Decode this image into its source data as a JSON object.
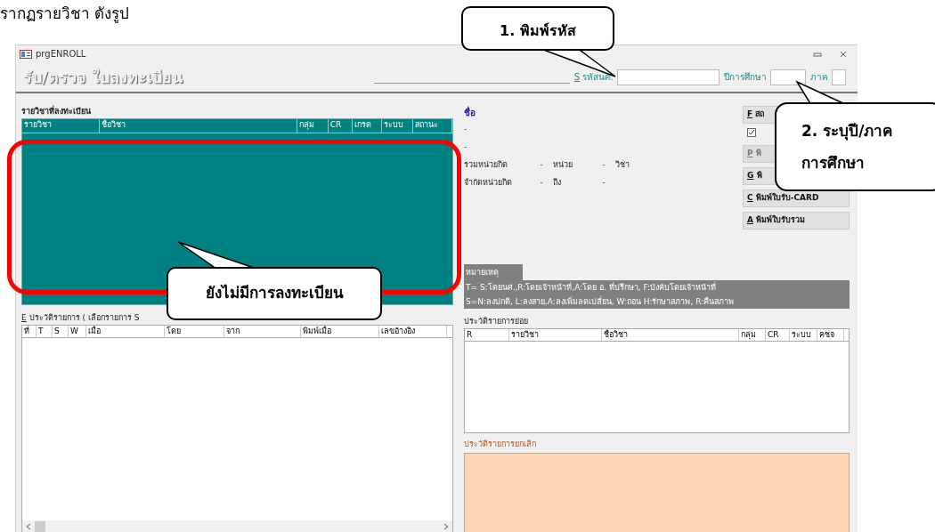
{
  "caption": "รากฏรายวิชา ดังรูป",
  "window": {
    "title": "prgENROLL",
    "form_title": "รับ/ตรวจ ใบลงทะเบียน"
  },
  "header_fields": [
    {
      "key": "S",
      "label": "รหัสนศ."
    },
    {
      "label": "ปีการศึกษา"
    },
    {
      "label": "ภาค"
    }
  ],
  "registered": {
    "title": "รายวิชาที่ลงทะเบียน",
    "columns": [
      "รายวิชา",
      "ชื่อวิชา",
      "กลุ่ม",
      "CR",
      "เกรด",
      "ระบบ",
      "สถานะ"
    ]
  },
  "student": {
    "name_label": "ชื่อ",
    "lines": [
      "-",
      "-"
    ],
    "rows": [
      [
        "รวมหน่วยกิต",
        "-",
        "หน่วย",
        "-",
        "วิชา"
      ],
      [
        "จำกัดหน่วยกิต",
        "-",
        "ถึง",
        "-"
      ]
    ]
  },
  "buttons": [
    {
      "key": "F",
      "label": "สถ",
      "disabled": false
    },
    {
      "kind": "checkbox",
      "checked": true
    },
    {
      "key": "P",
      "label": "พิ",
      "disabled": true
    },
    {
      "key": "G",
      "label": "พิ",
      "disabled": false
    },
    {
      "key": "C",
      "label": "พิมพ์ใบรับ-CARD",
      "disabled": false
    },
    {
      "key": "A",
      "label": "พิมพ์ใบรับรวม",
      "disabled": false
    }
  ],
  "note": {
    "tab": "หมายเหตุ",
    "lines": [
      "T= S:โดยนศ.,R:โดยเจ้าหน้าที่,A:โดย อ. ที่ปรึกษา, F:บังคับโดยเจ้าหน้าที่",
      "S=N:ลงปกติ, L:ลงสาย,A:ลงเพิ่มลดเปลี่ยน, W:ถอน H:รักษาสภาพ, R:คืนสภาพ"
    ]
  },
  "history": {
    "key": "E",
    "title": "ประวัติรายการ ( เลือกรายการ S",
    "columns": [
      "ที่",
      "T",
      "S",
      "W",
      "เมื่อ",
      "โดย",
      "จาก",
      "พิมพ์เมื่อ",
      "เลขอ้างอิง"
    ]
  },
  "sub_history": {
    "title": "ประวัติรายการย่อย",
    "columns": [
      "R",
      "รายวิชา",
      "ชื่อวิชา",
      "กลุ่ม",
      "CR",
      "ระบบ",
      "คชจ"
    ]
  },
  "cancel_history": {
    "title": "ประวัติรายการยกเลิก"
  },
  "callouts": [
    "1. พิมพ์รหัส",
    "2. ระบุปี/ภาค\nการศึกษา",
    "ยังไม่มีการลงทะเบียน"
  ]
}
